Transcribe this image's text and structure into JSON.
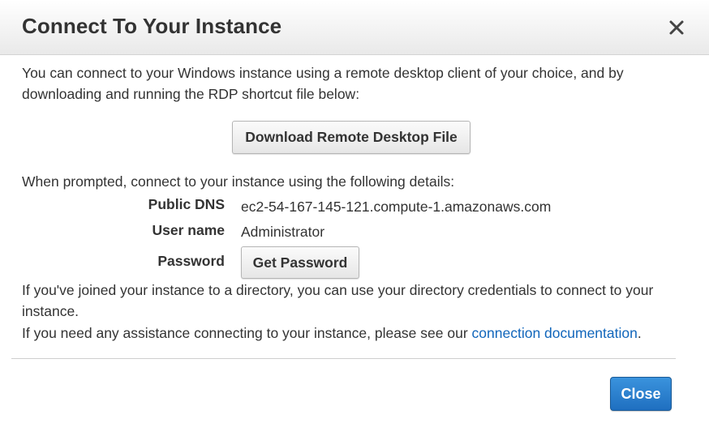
{
  "dialog": {
    "title": "Connect To Your Instance",
    "close_icon": "close-x-icon"
  },
  "intro": {
    "line1": "You can connect to your Windows instance using a remote desktop client of your choice, and by",
    "line2": "downloading and running the RDP shortcut file below:"
  },
  "download_button": {
    "label": "Download Remote Desktop File"
  },
  "details": {
    "prompt": "When prompted, connect to your instance using the following details:",
    "public_dns_label": "Public DNS",
    "public_dns_value": "ec2-54-167-145-121.compute-1.amazonaws.com",
    "user_name_label": "User name",
    "user_name_value": "Administrator",
    "password_label": "Password",
    "get_password_label": "Get Password"
  },
  "directory_note": {
    "line1": "If you've joined your instance to a directory, you can use your directory credentials to connect to your",
    "line2": "instance."
  },
  "assistance": {
    "text": "If you need any assistance connecting to your instance, please see our",
    "link_text": "connection documentation",
    "suffix": "."
  },
  "footer": {
    "close_label": "Close"
  },
  "colors": {
    "link": "#1166bb",
    "primary_button": "#2a7fd0",
    "text": "#333333"
  }
}
